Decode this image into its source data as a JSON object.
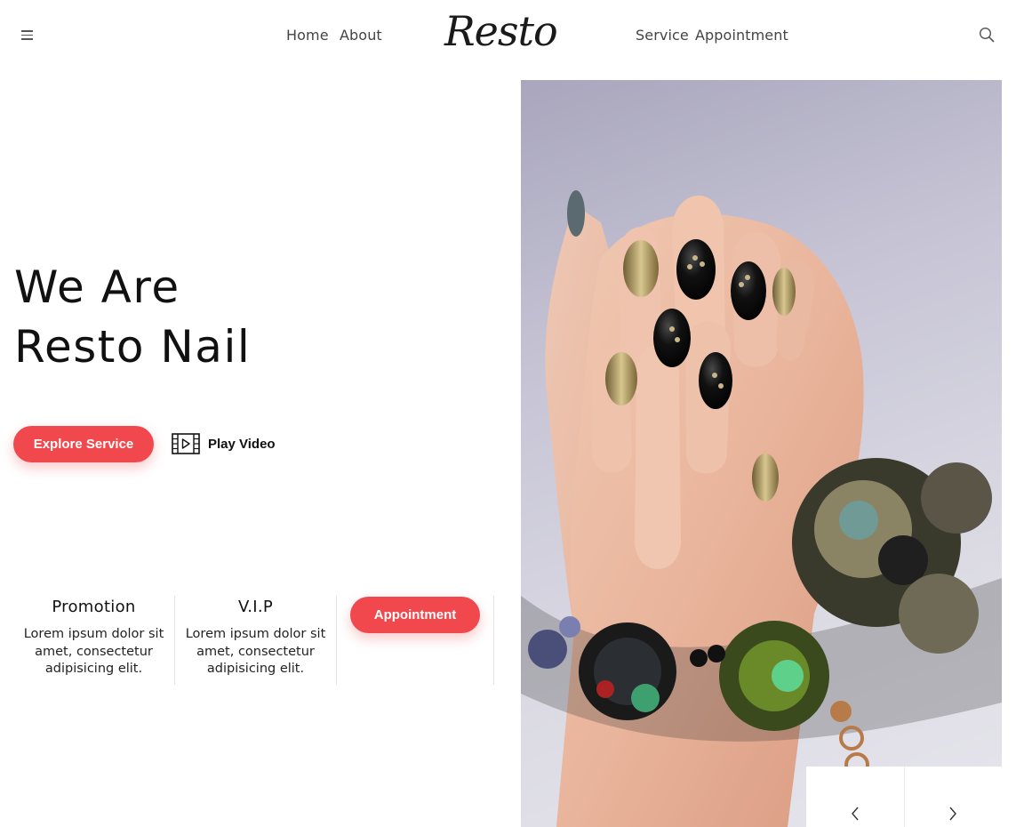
{
  "header": {
    "menu_icon": "hamburger-menu-icon",
    "nav_left": [
      "Home",
      "About"
    ],
    "logo": "Resto",
    "nav_right": [
      "Service",
      "Appointment"
    ],
    "search_icon": "search-icon"
  },
  "hero": {
    "title_line1": "We Are",
    "title_line2": "Resto Nail",
    "explore_label": "Explore Service",
    "play_icon": "film-play-icon",
    "play_label": "Play Video",
    "image_icon": "manicured-hand-photo"
  },
  "features": [
    {
      "title": "Promotion",
      "text": "Lorem ipsum dolor sit amet, consectetur adipisicing elit."
    },
    {
      "title": "V.I.P",
      "text": "Lorem ipsum dolor sit amet, consectetur adipisicing elit."
    }
  ],
  "appointment_label": "Appointment",
  "slider": {
    "prev_icon": "chevron-left-icon",
    "next_icon": "chevron-right-icon"
  },
  "colors": {
    "accent": "#f0484c",
    "text": "#111111",
    "nav_text": "#444444"
  }
}
